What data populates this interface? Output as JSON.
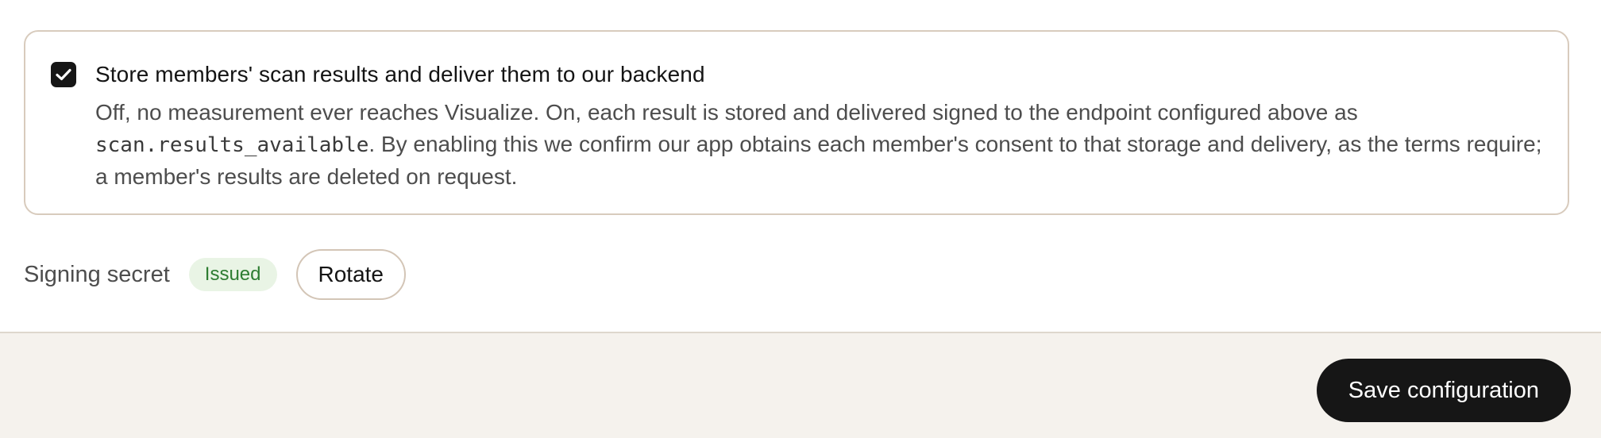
{
  "consent": {
    "checked": true,
    "title": "Store members' scan results and deliver them to our backend",
    "description_before": "Off, no measurement ever reaches Visualize. On, each result is stored and delivered signed to the endpoint configured above as ",
    "event_name": "scan.results_available",
    "description_after": ". By enabling this we confirm our app obtains each member's consent to that storage and delivery, as the terms require; a member's results are deleted on request."
  },
  "signing_secret": {
    "label": "Signing secret",
    "status": "Issued",
    "rotate_label": "Rotate"
  },
  "footer": {
    "save_label": "Save configuration"
  },
  "icons": {
    "checkbox": "check-icon"
  },
  "colors": {
    "primary": "#161616",
    "card_border": "#d8cbbd",
    "badge_bg": "#e9f4e5",
    "badge_text": "#2e7d32",
    "footer_bg": "#f5f2ed"
  }
}
